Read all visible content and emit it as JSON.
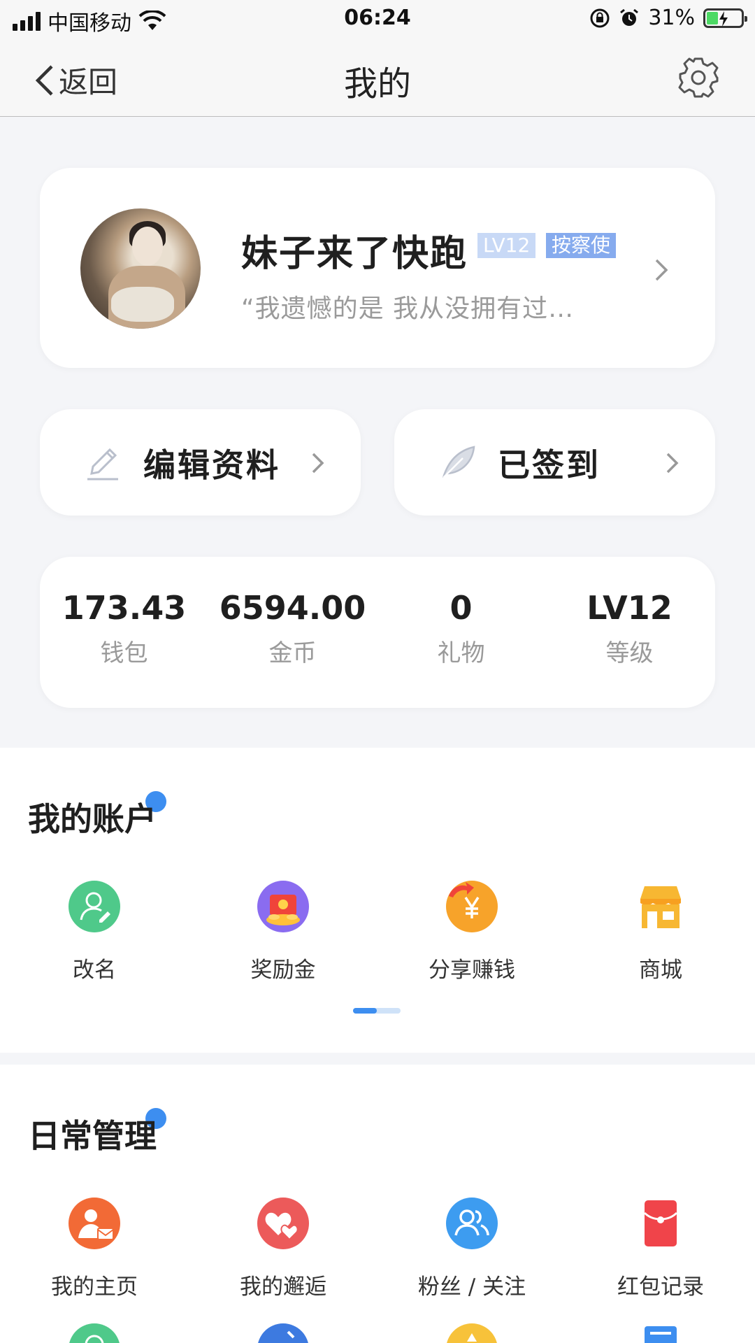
{
  "status_bar": {
    "carrier": "中国移动",
    "time": "06:24",
    "battery_percent": "31%",
    "battery_level": 0.31,
    "icons": [
      "signal-icon",
      "wifi-icon",
      "orientation-lock-icon",
      "alarm-icon",
      "battery-charging-icon"
    ]
  },
  "nav": {
    "back_label": "返回",
    "title": "我的",
    "settings_icon": "gear-icon"
  },
  "profile": {
    "name": "妹子来了快跑",
    "level_tag": "LV12",
    "role_tag": "按察使",
    "signature": "“我遗憾的是 我从没拥有过…"
  },
  "actions": {
    "edit_label": "编辑资料",
    "sign_label": "已签到"
  },
  "stats": [
    {
      "value": "173.43",
      "label": "钱包"
    },
    {
      "value": "6594.00",
      "label": "金币"
    },
    {
      "value": "0",
      "label": "礼物"
    },
    {
      "value": "LV12",
      "label": "等级"
    }
  ],
  "account": {
    "title": "我的账户",
    "items": [
      {
        "label": "改名",
        "icon": "rename-user-icon",
        "color": "#4fc98a"
      },
      {
        "label": "奖励金",
        "icon": "reward-gift-icon",
        "color": "#8a6cf0"
      },
      {
        "label": "分享赚钱",
        "icon": "share-earn-yen-icon",
        "color": "#f7a32a"
      },
      {
        "label": "商城",
        "icon": "store-icon",
        "color": "#f7b732"
      }
    ],
    "page_index": 1,
    "page_count": 2
  },
  "daily": {
    "title": "日常管理",
    "items": [
      {
        "label": "我的主页",
        "icon": "homepage-user-icon",
        "color": "#f26a36"
      },
      {
        "label": "我的邂逅",
        "icon": "encounter-heart-icon",
        "color": "#ec5a5a"
      },
      {
        "label": "粉丝 / 关注",
        "icon": "fans-follow-icon",
        "color": "#3d9cf0"
      },
      {
        "label": "红包记录",
        "icon": "red-envelope-icon",
        "color": "#f0444a"
      }
    ]
  }
}
